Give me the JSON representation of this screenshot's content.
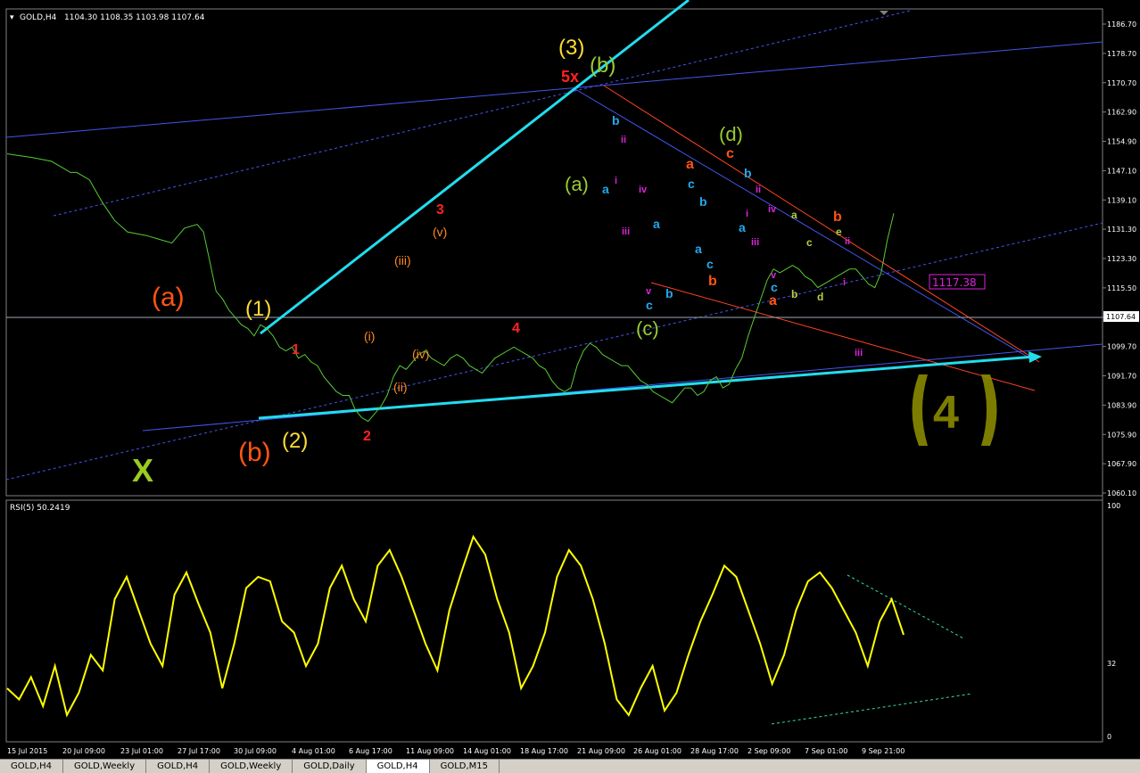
{
  "window": {
    "symbol_title": "GOLD,H4",
    "ohlc_text": "1104.30 1108.35 1103.98 1107.64",
    "current_price": "1107.64",
    "marked_price": "1117.38"
  },
  "rsi": {
    "title": "RSI(5) 50.2419",
    "levels": [
      "100",
      "32",
      "0"
    ]
  },
  "tabs": [
    {
      "label": "GOLD,H4",
      "active": false
    },
    {
      "label": "GOLD,Weekly",
      "active": false
    },
    {
      "label": "GOLD,H4",
      "active": false
    },
    {
      "label": "GOLD,Weekly",
      "active": false
    },
    {
      "label": "GOLD,Daily",
      "active": false
    },
    {
      "label": "GOLD,H4",
      "active": true
    },
    {
      "label": "GOLD,M15",
      "active": false
    }
  ],
  "chart_data": {
    "type": "line",
    "price_axis": {
      "ticks": [
        "1186.70",
        "1178.70",
        "1170.70",
        "1162.90",
        "1154.90",
        "1147.10",
        "1139.10",
        "1131.30",
        "1123.30",
        "1115.50",
        "1107.50",
        "1099.70",
        "1091.70",
        "1083.90",
        "1075.90",
        "1067.90",
        "1060.10"
      ],
      "ylim": [
        1058,
        1189
      ]
    },
    "time_axis": {
      "labels": [
        "15 Jul 2015",
        "20 Jul 09:00",
        "23 Jul 01:00",
        "27 Jul 17:00",
        "30 Jul 09:00",
        "4 Aug 01:00",
        "6 Aug 17:00",
        "11 Aug 09:00",
        "14 Aug 01:00",
        "18 Aug 17:00",
        "21 Aug 09:00",
        "26 Aug 01:00",
        "28 Aug 17:00",
        "2 Sep 09:00",
        "7 Sep 01:00",
        "9 Sep 21:00"
      ]
    },
    "price_series": {
      "name": "GOLD,H4",
      "color": "#55cc33",
      "x": [
        0,
        8,
        14,
        16,
        18,
        20,
        22,
        26,
        30,
        34,
        38,
        44,
        48,
        52,
        56,
        60,
        62,
        64,
        66,
        68,
        70,
        72,
        74,
        76,
        78,
        80,
        82,
        84,
        86,
        88,
        90,
        92,
        94,
        96,
        98,
        100,
        102,
        104,
        106,
        108,
        110,
        112,
        114,
        116,
        118,
        120,
        122,
        124,
        126,
        128,
        130,
        132,
        134,
        136,
        138,
        140,
        142,
        144,
        146,
        148,
        150,
        152,
        154,
        156,
        158,
        160,
        162,
        164,
        166,
        168,
        170,
        172,
        174,
        176,
        178,
        180,
        182,
        184,
        186,
        188,
        190,
        192,
        194,
        196,
        198,
        200,
        202,
        204,
        206,
        208,
        210,
        212,
        214,
        216,
        218,
        220,
        222,
        224,
        226,
        228,
        230,
        232,
        234,
        236,
        238,
        240,
        242,
        244,
        246,
        248,
        250,
        252,
        254,
        256,
        258,
        260,
        262,
        264,
        266,
        268,
        270,
        272,
        274,
        276,
        278,
        280,
        282,
        284,
        286,
        288,
        290
      ],
      "y": [
        1150,
        1149,
        1148,
        1147,
        1146,
        1145,
        1145,
        1143,
        1137,
        1132,
        1129,
        1128,
        1127,
        1126,
        1130,
        1131,
        1129,
        1121,
        1113,
        1111,
        1108,
        1106,
        1104,
        1103,
        1101,
        1104,
        1103,
        1101,
        1098,
        1097,
        1098,
        1095,
        1096,
        1094,
        1093,
        1090,
        1088,
        1086,
        1085,
        1085,
        1081,
        1079,
        1078,
        1080,
        1082,
        1085,
        1090,
        1093,
        1092,
        1094,
        1096,
        1097,
        1095,
        1094,
        1093,
        1095,
        1096,
        1095,
        1093,
        1092,
        1091,
        1093,
        1095,
        1096,
        1097,
        1098,
        1097,
        1096,
        1095,
        1093,
        1092,
        1089,
        1087,
        1086,
        1087,
        1093,
        1097,
        1099,
        1098,
        1096,
        1095,
        1094,
        1093,
        1093,
        1091,
        1089,
        1088,
        1086,
        1085,
        1084,
        1083,
        1085,
        1087,
        1087,
        1085,
        1086,
        1089,
        1090,
        1087,
        1088,
        1092,
        1095,
        1101,
        1106,
        1111,
        1116,
        1119,
        1118,
        1119,
        1120,
        1119,
        1117,
        1116,
        1114,
        1115,
        1116,
        1117,
        1118,
        1119,
        1119,
        1117,
        1115,
        1114,
        1118,
        1127,
        1134
      ]
    },
    "rsi_series": {
      "name": "RSI(5)",
      "color": "#ffff00",
      "ylim": [
        0,
        100
      ],
      "x": [
        0,
        4,
        8,
        12,
        16,
        20,
        24,
        28,
        32,
        36,
        40,
        44,
        48,
        52,
        56,
        60,
        64,
        68,
        72,
        76,
        80,
        84,
        88,
        92,
        96,
        100,
        104,
        108,
        112,
        116,
        120,
        124,
        128,
        132,
        136,
        140,
        144,
        148,
        152,
        156,
        160,
        164,
        168,
        172,
        176,
        180,
        184,
        188,
        192,
        196,
        200,
        204,
        208,
        212,
        216,
        220,
        224,
        228,
        232,
        236,
        240,
        244,
        248,
        252,
        256,
        260,
        264,
        268,
        272,
        276,
        280,
        284,
        288,
        292,
        296,
        300
      ],
      "y": [
        20,
        15,
        25,
        12,
        30,
        8,
        18,
        35,
        28,
        60,
        70,
        55,
        40,
        30,
        62,
        72,
        58,
        45,
        20,
        40,
        65,
        70,
        68,
        50,
        45,
        30,
        40,
        65,
        75,
        60,
        50,
        75,
        82,
        70,
        55,
        40,
        28,
        55,
        72,
        88,
        80,
        60,
        45,
        20,
        30,
        45,
        70,
        82,
        75,
        60,
        40,
        15,
        8,
        20,
        30,
        10,
        18,
        35,
        50,
        62,
        75,
        70,
        55,
        40,
        22,
        35,
        55,
        68,
        72,
        65,
        55,
        45,
        30,
        50,
        60,
        44
      ]
    },
    "annotations": {
      "primary_waves": [
        "(a)",
        "(b)",
        "(1)",
        "(2)",
        "(3)",
        "(4)",
        "X",
        "5x"
      ],
      "minor_waves": [
        "1",
        "2",
        "3",
        "4",
        "(i)",
        "(ii)",
        "(iii)",
        "(iv)",
        "(v)",
        "(a)",
        "(b)",
        "(c)",
        "(d)"
      ],
      "sub_labels": [
        "a",
        "b",
        "c",
        "d",
        "e",
        "i",
        "ii",
        "iii",
        "iv",
        "v"
      ]
    }
  }
}
